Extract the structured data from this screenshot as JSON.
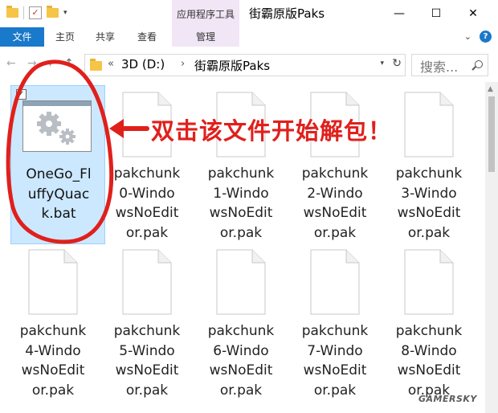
{
  "titlebar": {
    "contextual_tab_group": "应用程序工具",
    "window_title": "街霸原版Paks",
    "minimize": "—",
    "maximize": "☐",
    "close": "✕"
  },
  "ribbon": {
    "tabs": [
      "文件",
      "主页",
      "共享",
      "查看",
      "管理"
    ],
    "file_tab_color": "#1979ca",
    "context_color": "#f1e6f5"
  },
  "address": {
    "segments": [
      "3D (D:)",
      "街霸原版Paks"
    ],
    "overflow": "«",
    "separator": "›",
    "search_placeholder": "搜索..."
  },
  "items": [
    {
      "name": "OneGo_FluffyQuack.bat",
      "lines": [
        "OneGo_Fl",
        "uffyQuac",
        "k.bat"
      ],
      "icon": "batch-file-gear-icon",
      "selected": true
    },
    {
      "name": "pakchunk0-WindowsNoEditor.pak",
      "lines": [
        "pakchunk",
        "0-Windo",
        "wsNoEdit",
        "or.pak"
      ],
      "icon": "blank-file-icon"
    },
    {
      "name": "pakchunk1-WindowsNoEditor.pak",
      "lines": [
        "pakchunk",
        "1-Windo",
        "wsNoEdit",
        "or.pak"
      ],
      "icon": "blank-file-icon"
    },
    {
      "name": "pakchunk2-WindowsNoEditor.pak",
      "lines": [
        "pakchunk",
        "2-Windo",
        "wsNoEdit",
        "or.pak"
      ],
      "icon": "blank-file-icon"
    },
    {
      "name": "pakchunk3-WindowsNoEditor.pak",
      "lines": [
        "pakchunk",
        "3-Windo",
        "wsNoEdit",
        "or.pak"
      ],
      "icon": "blank-file-icon"
    },
    {
      "name": "pakchunk4-WindowsNoEditor.pak",
      "lines": [
        "pakchunk",
        "4-Windo",
        "wsNoEdit",
        "or.pak"
      ],
      "icon": "blank-file-icon"
    },
    {
      "name": "pakchunk5-WindowsNoEditor.pak",
      "lines": [
        "pakchunk",
        "5-Windo",
        "wsNoEdit",
        "or.pak"
      ],
      "icon": "blank-file-icon"
    },
    {
      "name": "pakchunk6-WindowsNoEditor.pak",
      "lines": [
        "pakchunk",
        "6-Windo",
        "wsNoEdit",
        "or.pak"
      ],
      "icon": "blank-file-icon"
    },
    {
      "name": "pakchunk7-WindowsNoEditor.pak",
      "lines": [
        "pakchunk",
        "7-Windo",
        "wsNoEdit",
        "or.pak"
      ],
      "icon": "blank-file-icon"
    },
    {
      "name": "pakchunk8-WindowsNoEditor.pak",
      "lines": [
        "pakchunk",
        "8-Windo",
        "wsNoEdit",
        "or.pak"
      ],
      "icon": "blank-file-icon"
    }
  ],
  "annotation": {
    "text": "双击该文件开始解包！",
    "color": "#e0201c"
  },
  "watermark": "GAMERSKY"
}
